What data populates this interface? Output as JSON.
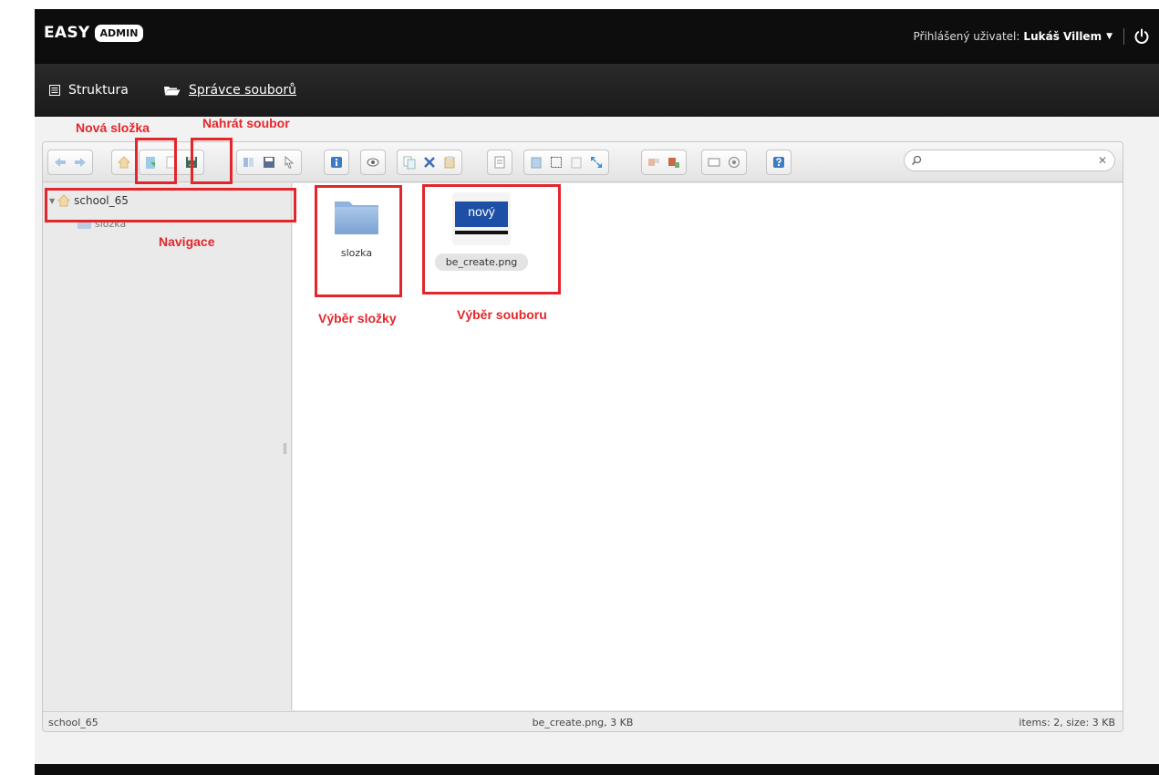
{
  "header": {
    "logo_text": "EASY",
    "logo_badge": "ADMIN",
    "user_label": "Přihlášený uživatel:",
    "user_name": "Lukáš Villem"
  },
  "nav": {
    "structure_label": "Struktura",
    "file_manager_label": "Správce souborů"
  },
  "annotations": {
    "new_folder": "Nová složka",
    "upload_file": "Nahrát soubor",
    "navigation": "Navigace",
    "folder_select": "Výběr složky",
    "file_select": "Výběr souboru"
  },
  "toolbar": {
    "search_value": "",
    "icons": [
      "back-icon",
      "forward-icon",
      "home-icon",
      "new-folder-icon",
      "new-file-icon",
      "upload-icon",
      "copy-icon",
      "save-icon",
      "select-icon",
      "info-icon",
      "preview-icon",
      "copy-icon",
      "cut-icon",
      "paste-icon",
      "edit-icon",
      "duplicate-icon",
      "select-all-icon",
      "invert-icon",
      "resize-icon",
      "extract-icon",
      "archive-icon",
      "view-icon",
      "sort-icon",
      "help-icon"
    ]
  },
  "tree": {
    "root": "school_65",
    "children": [
      "slozka"
    ]
  },
  "files": [
    {
      "name": "slozka",
      "type": "folder"
    },
    {
      "name": "be_create.png",
      "type": "image",
      "thumb_text": "nový"
    }
  ],
  "status": {
    "path": "school_65",
    "selected": "be_create.png, 3 KB",
    "summary": "items: 2, size: 3 KB"
  },
  "colors": {
    "annotation": "#e3262b",
    "topbar": "#0d0d0d",
    "folder": "#8fb3dc"
  }
}
